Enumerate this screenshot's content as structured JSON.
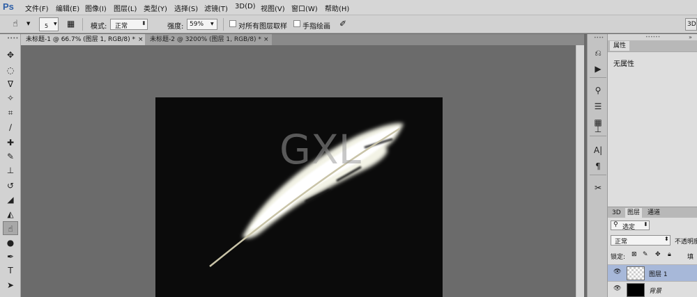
{
  "app": {
    "logo": "Ps"
  },
  "menu": [
    {
      "label": "文件(F)"
    },
    {
      "label": "编辑(E)"
    },
    {
      "label": "图像(I)"
    },
    {
      "label": "图层(L)"
    },
    {
      "label": "类型(Y)"
    },
    {
      "label": "选择(S)"
    },
    {
      "label": "滤镜(T)"
    },
    {
      "label": "3D(D)"
    },
    {
      "label": "视图(V)"
    },
    {
      "label": "窗口(W)"
    },
    {
      "label": "帮助(H)"
    }
  ],
  "options": {
    "brush_size": "5",
    "mode_label": "模式:",
    "mode_value": "正常",
    "strength_label": "强度:",
    "strength_value": "59%",
    "sample_all_label": "对所有图层取样",
    "finger_paint_label": "手指绘画",
    "workspace_value": "3D"
  },
  "tabs": [
    {
      "label": "未标题-1 @ 66.7% (图层 1, RGB/8) *",
      "close": "×",
      "active": true
    },
    {
      "label": "未标题-2 @ 3200% (图层 1, RGB/8) *",
      "close": "×",
      "active": false
    }
  ],
  "tools": [
    {
      "name": "move-tool-icon",
      "glyph": "✥"
    },
    {
      "name": "marquee-tool-icon",
      "glyph": "◌"
    },
    {
      "name": "lasso-tool-icon",
      "glyph": "ᐁ"
    },
    {
      "name": "quick-select-tool-icon",
      "glyph": "✧"
    },
    {
      "name": "crop-tool-icon",
      "glyph": "⌗"
    },
    {
      "name": "eyedropper-tool-icon",
      "glyph": "∕"
    },
    {
      "name": "healing-brush-tool-icon",
      "glyph": "✚"
    },
    {
      "name": "brush-tool-icon",
      "glyph": "✎"
    },
    {
      "name": "stamp-tool-icon",
      "glyph": "⊥"
    },
    {
      "name": "history-brush-tool-icon",
      "glyph": "↺"
    },
    {
      "name": "eraser-tool-icon",
      "glyph": "◢"
    },
    {
      "name": "paint-bucket-tool-icon",
      "glyph": "◭"
    },
    {
      "name": "smudge-tool-icon",
      "glyph": "☝"
    },
    {
      "name": "dodge-tool-icon",
      "glyph": "●"
    },
    {
      "name": "pen-tool-icon",
      "glyph": "✒"
    },
    {
      "name": "type-tool-icon",
      "glyph": "T"
    },
    {
      "name": "path-select-tool-icon",
      "glyph": "➤"
    }
  ],
  "dock": [
    {
      "name": "history-panel-icon",
      "glyph": "⎌"
    },
    {
      "name": "actions-panel-icon",
      "glyph": "▶"
    },
    {
      "name": "brush-panel-icon",
      "glyph": "⚲"
    },
    {
      "name": "adjustments-panel-icon",
      "glyph": "☰"
    },
    {
      "name": "clone-source-panel-icon",
      "glyph": "▦"
    },
    {
      "name": "tool-presets-panel-icon",
      "glyph": "⊥"
    },
    {
      "name": "character-panel-icon",
      "glyph": "A|"
    },
    {
      "name": "paragraph-panel-icon",
      "glyph": "¶"
    },
    {
      "name": "tools-panel-icon",
      "glyph": "✂"
    }
  ],
  "properties": {
    "tab": "属性",
    "empty_text": "无属性"
  },
  "layers_panel": {
    "tabs": [
      "3D",
      "图层",
      "通道"
    ],
    "filter_label": "选定",
    "blend_mode": "正常",
    "opacity_label": "不透明度",
    "lock_label": "锁定:",
    "fill_label": "填",
    "layers": [
      {
        "name": "图层 1",
        "selected": true
      },
      {
        "name": "背景",
        "selected": false
      }
    ]
  },
  "watermark": "GXL"
}
